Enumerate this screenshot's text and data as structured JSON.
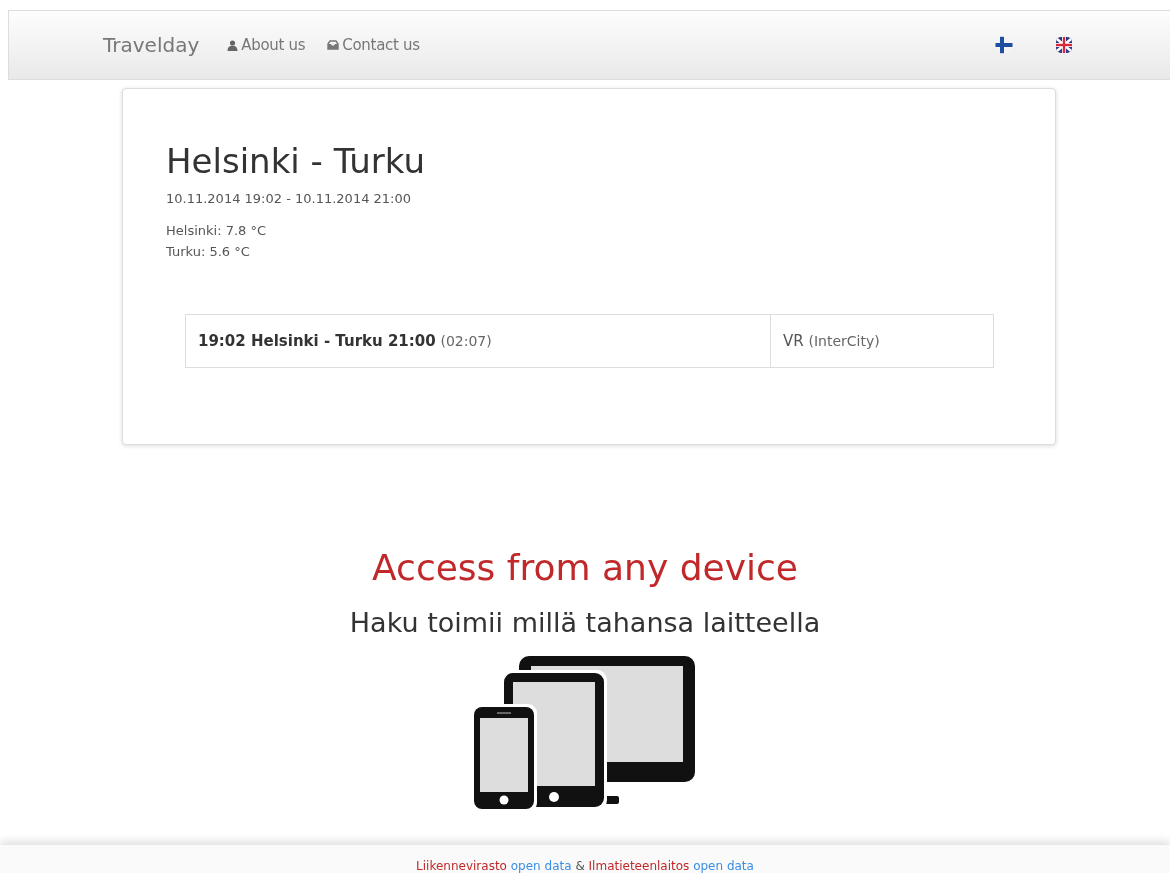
{
  "navbar": {
    "brand": "Travelday",
    "links": [
      {
        "label": "About us",
        "kind": "user"
      },
      {
        "label": "Contact us",
        "kind": "mail"
      }
    ],
    "languages": [
      {
        "kind": "fi"
      },
      {
        "kind": "gb"
      }
    ]
  },
  "journey": {
    "title": "Helsinki - Turku",
    "period": "10.11.2014 19:02 - 10.11.2014 21:00",
    "weather": [
      "Helsinki: 7.8 °C",
      "Turku: 5.6 °C"
    ],
    "connections": [
      {
        "route": "19:02 Helsinki - Turku 21:00",
        "duration": "(02:07)",
        "operator": "VR",
        "train": "(InterCity)"
      }
    ]
  },
  "promo": {
    "heading": "Access from any device",
    "subheading": "Haku toimii millä tahansa laitteella"
  },
  "footer": [
    {
      "text": "Liikennevirasto",
      "kind": "source"
    },
    {
      "text": "open data",
      "kind": "link"
    },
    {
      "text": "&",
      "kind": "plain"
    },
    {
      "text": "Ilmatieteenlaitos",
      "kind": "source"
    },
    {
      "text": "open data",
      "kind": "link"
    }
  ]
}
